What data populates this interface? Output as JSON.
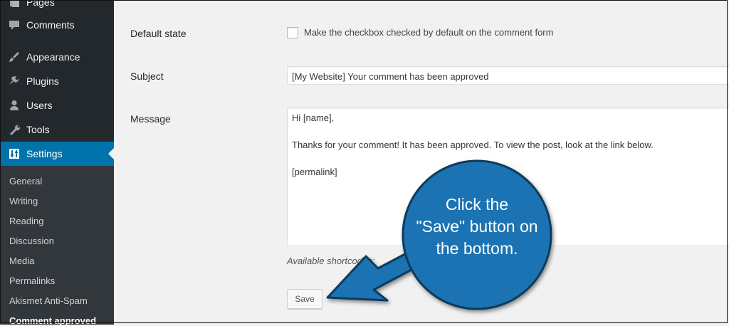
{
  "sidebar": {
    "items": [
      {
        "label": "Pages",
        "icon": "pages-icon"
      },
      {
        "label": "Comments",
        "icon": "comments-icon"
      },
      {
        "label": "Appearance",
        "icon": "appearance-icon"
      },
      {
        "label": "Plugins",
        "icon": "plugins-icon"
      },
      {
        "label": "Users",
        "icon": "users-icon"
      },
      {
        "label": "Tools",
        "icon": "tools-icon"
      },
      {
        "label": "Settings",
        "icon": "settings-icon",
        "active": true
      }
    ],
    "submenu": [
      "General",
      "Writing",
      "Reading",
      "Discussion",
      "Media",
      "Permalinks",
      "Akismet Anti-Spam",
      "Comment approved"
    ],
    "submenu_current": "Comment approved"
  },
  "form": {
    "default_state": {
      "label": "Default state",
      "checkbox_label": "Make the checkbox checked by default on the comment form",
      "checked": false
    },
    "subject": {
      "label": "Subject",
      "value": "[My Website] Your comment has been approved"
    },
    "message": {
      "label": "Message",
      "lines": [
        "Hi [name],",
        "Thanks for your comment! It has been approved. To view the post, look at the link below.",
        "[permalink]"
      ]
    },
    "shortcodes_label": "Available shortcodes:",
    "save_label": "Save"
  },
  "callout": {
    "lines": [
      "Click the",
      "\"Save\" button on",
      "the bottom."
    ]
  },
  "colors": {
    "sidebar_bg": "#23282d",
    "submenu_bg": "#32373c",
    "active_bg": "#0073aa",
    "callout_fill": "#1f73b3",
    "callout_stroke": "#0d3a5c"
  }
}
